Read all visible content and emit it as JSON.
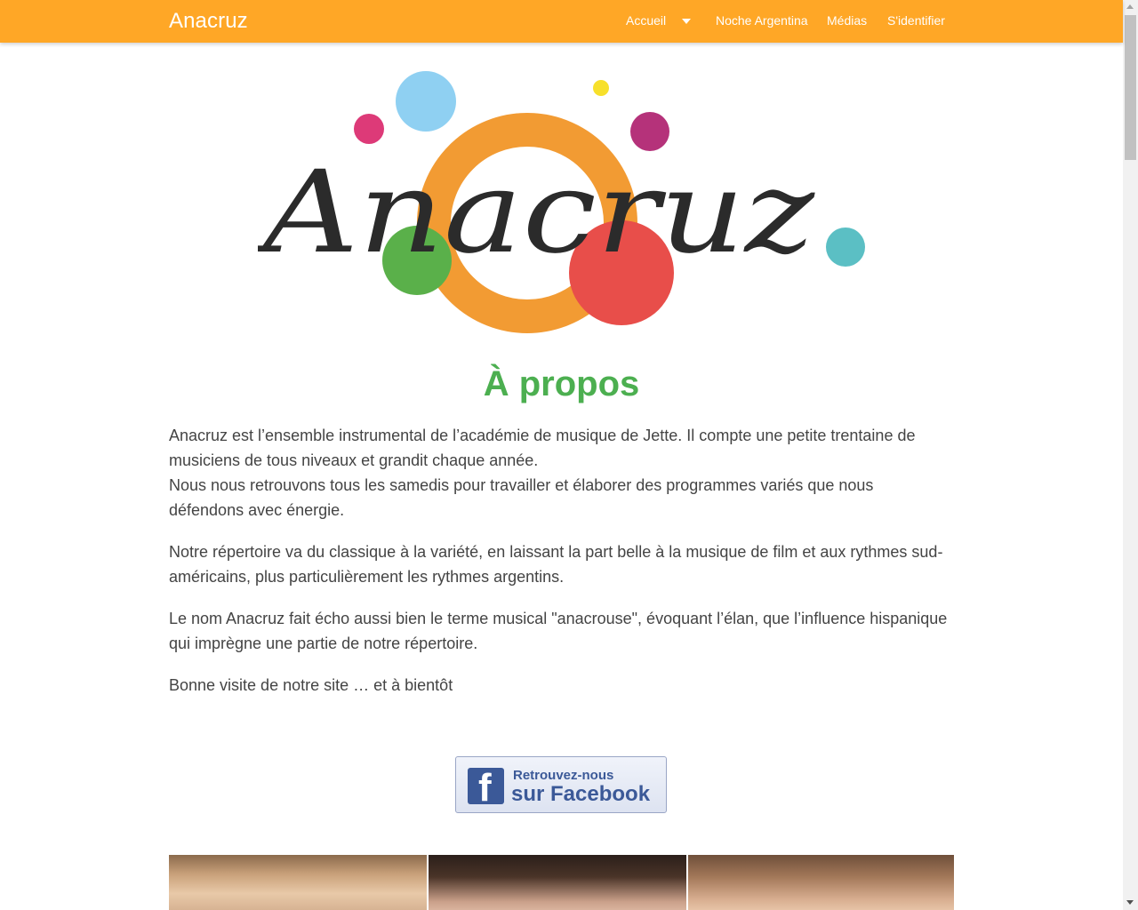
{
  "navbar": {
    "brand": "Anacruz",
    "items": [
      {
        "label": "Accueil",
        "has_dropdown": true
      },
      {
        "label": "Noche Argentina"
      },
      {
        "label": "Médias"
      },
      {
        "label": "S'identifier"
      }
    ]
  },
  "logo": {
    "text": "Anacruz"
  },
  "about": {
    "title": "À propos",
    "paragraph_1": [
      "Anacruz est l’ensemble instrumental de l’académie de musique de Jette. Il compte une petite trentaine de musiciens de tous niveaux et grandit chaque année.",
      "Nous nous retrouvons tous les samedis pour travailler et élaborer des programmes variés que nous défendons avec énergie."
    ],
    "paragraph_2": "Notre répertoire va du classique à la variété, en laissant la part belle à la musique de film et aux rythmes sud-américains, plus particulièrement les rythmes argentins.",
    "paragraph_3": "Le nom Anacruz fait écho aussi bien le terme musical \"anacrouse\", évoquant l’élan, que l’influence hispanique qui imprègne une partie de notre répertoire.",
    "paragraph_4": "Bonne visite de notre site … et à bientôt"
  },
  "facebook_button": {
    "icon_letter": "f",
    "line_1": "Retrouvez-nous",
    "line_2": "sur Facebook"
  },
  "icons": {
    "dropdown": "caret-down-icon",
    "facebook": "facebook-icon"
  },
  "colors": {
    "navbar": "#ffa726",
    "title": "#4caf50",
    "facebook": "#3b5998",
    "logo_orange": "#f29b33",
    "logo_red": "#e84e4a",
    "logo_green": "#5ab04a",
    "logo_lightblue": "#8fd0f2",
    "logo_magenta": "#dd3a78",
    "logo_purple": "#b5327a",
    "logo_teal": "#5bbfc4",
    "logo_yellow": "#f7e02b"
  }
}
